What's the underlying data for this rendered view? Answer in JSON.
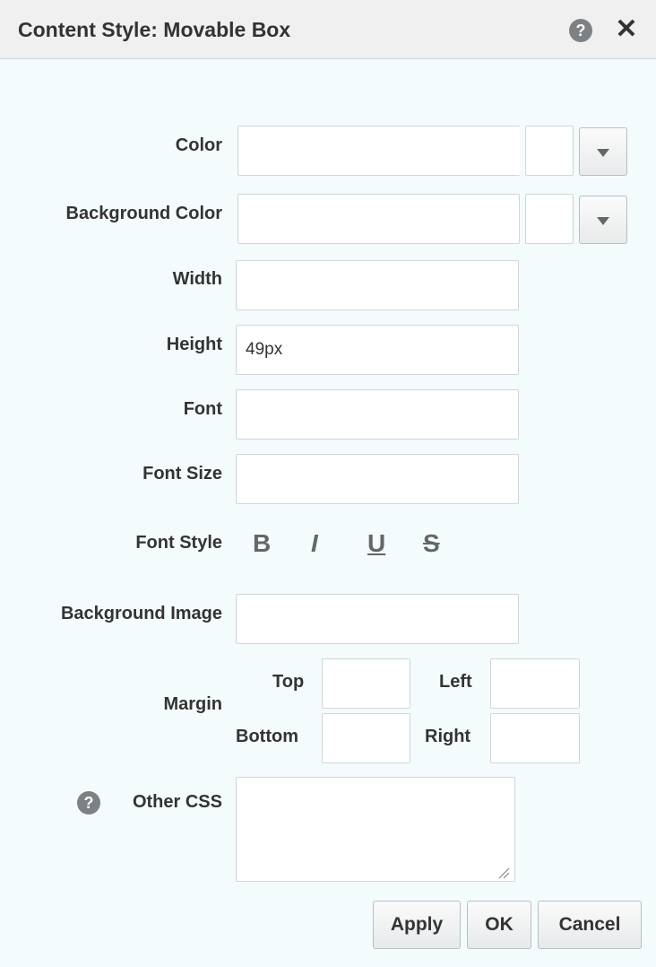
{
  "dialog": {
    "title": "Content Style: Movable Box",
    "help_icon": "question-circle-icon",
    "close_icon": "close-icon"
  },
  "labels": {
    "color": "Color",
    "background_color": "Background Color",
    "width": "Width",
    "height": "Height",
    "font": "Font",
    "font_size": "Font Size",
    "font_style": "Font Style",
    "background_image": "Background Image",
    "margin": "Margin",
    "other_css": "Other CSS"
  },
  "fields": {
    "color": "",
    "background_color": "",
    "width": "",
    "height": "49px",
    "font": "",
    "font_size": "",
    "background_image": "",
    "margin_top": "",
    "margin_left": "",
    "margin_bottom": "",
    "margin_right": "",
    "other_css": ""
  },
  "font_style": {
    "bold": "B",
    "italic": "I",
    "underline": "U",
    "strikethrough": "S"
  },
  "margin": {
    "top": "Top",
    "left": "Left",
    "bottom": "Bottom",
    "right": "Right"
  },
  "buttons": {
    "apply": "Apply",
    "ok": "OK",
    "cancel": "Cancel"
  },
  "colors": {
    "background": "#f4fbfd",
    "titlebar": "#f0f0f0",
    "icon_gray": "#7d8184"
  }
}
